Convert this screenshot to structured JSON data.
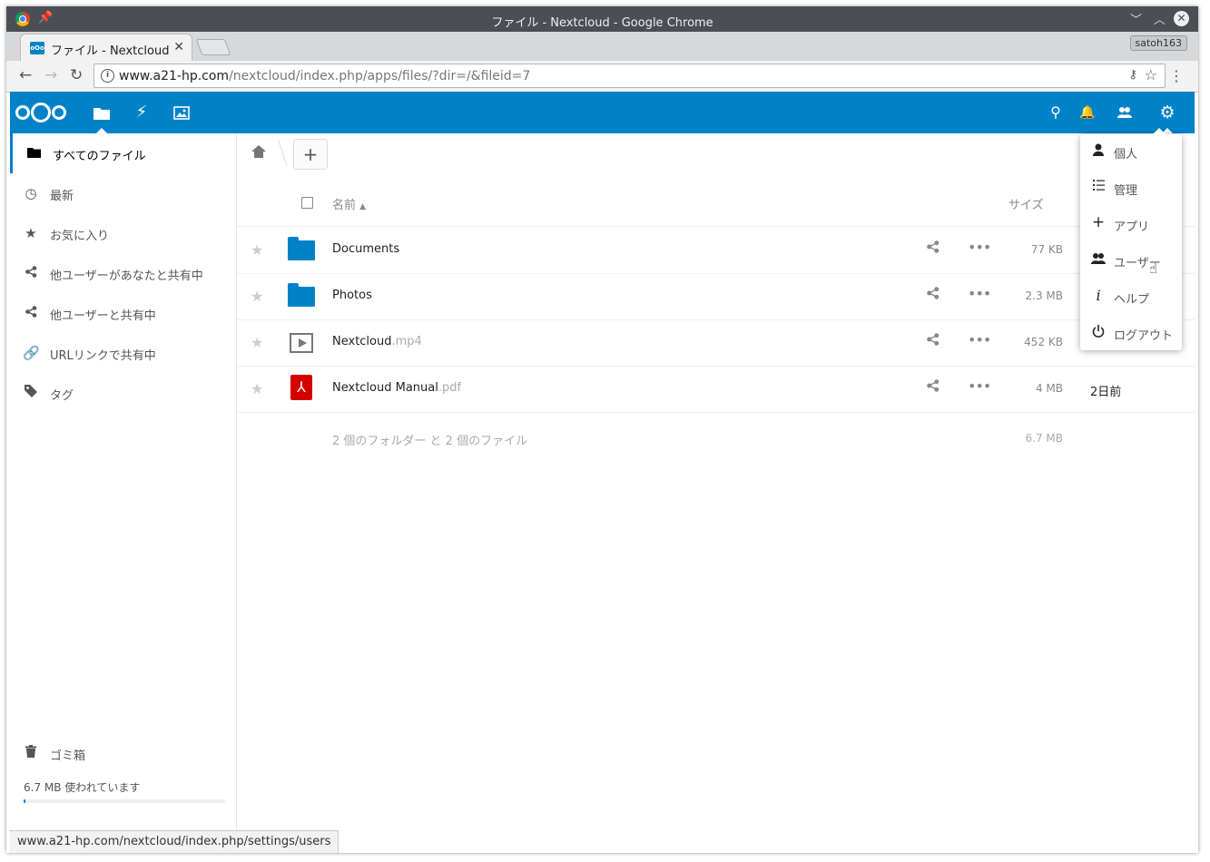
{
  "window": {
    "title": "ファイル - Nextcloud - Google Chrome"
  },
  "tab": {
    "label": "ファイル - Nextcloud",
    "close": "✕"
  },
  "profile": {
    "name": "satoh163"
  },
  "omnibox": {
    "url_host": "www.a21-hp.com",
    "url_path": "/nextcloud/index.php/apps/files/?dir=/&fileid=7"
  },
  "icons": {
    "brand": "#0082c9"
  },
  "sidebar": {
    "items": [
      {
        "label": "すべてのファイル",
        "icon": "folder-icon"
      },
      {
        "label": "最新",
        "icon": "clock-icon"
      },
      {
        "label": "お気に入り",
        "icon": "star-icon"
      },
      {
        "label": "他ユーザーがあなたと共有中",
        "icon": "share-icon"
      },
      {
        "label": "他ユーザーと共有中",
        "icon": "share-icon"
      },
      {
        "label": "URLリンクで共有中",
        "icon": "link-icon"
      },
      {
        "label": "タグ",
        "icon": "tag-icon"
      }
    ],
    "trash": "ゴミ箱",
    "quota": {
      "text": "6.7 MB 使われています",
      "fraction": 0.01
    },
    "settings": "設定"
  },
  "toolbar": {
    "add_label": "+"
  },
  "table": {
    "header_name": "名前",
    "header_size": "サイズ",
    "rows": [
      {
        "name": "Documents",
        "ext": "",
        "size": "77 KB",
        "date": "",
        "type": "folder"
      },
      {
        "name": "Photos",
        "ext": "",
        "size": "2.3 MB",
        "date": "",
        "type": "folder"
      },
      {
        "name": "Nextcloud",
        "ext": ".mp4",
        "size": "452 KB",
        "date": "",
        "type": "video"
      },
      {
        "name": "Nextcloud Manual",
        "ext": ".pdf",
        "size": "4 MB",
        "date": "2日前",
        "type": "pdf"
      }
    ],
    "summary": "2 個のフォルダー と 2 個のファイル",
    "summary_size": "6.7 MB"
  },
  "settings_menu": {
    "items": [
      {
        "label": "個人",
        "icon": "person-icon"
      },
      {
        "label": "管理",
        "icon": "list-icon"
      },
      {
        "label": "アプリ",
        "icon": "plus-icon"
      },
      {
        "label": "ユーザー",
        "icon": "users-icon"
      },
      {
        "label": "ヘルプ",
        "icon": "info-icon"
      },
      {
        "label": "ログアウト",
        "icon": "power-icon"
      }
    ]
  },
  "statusbar": {
    "text": "www.a21-hp.com/nextcloud/index.php/settings/users"
  }
}
